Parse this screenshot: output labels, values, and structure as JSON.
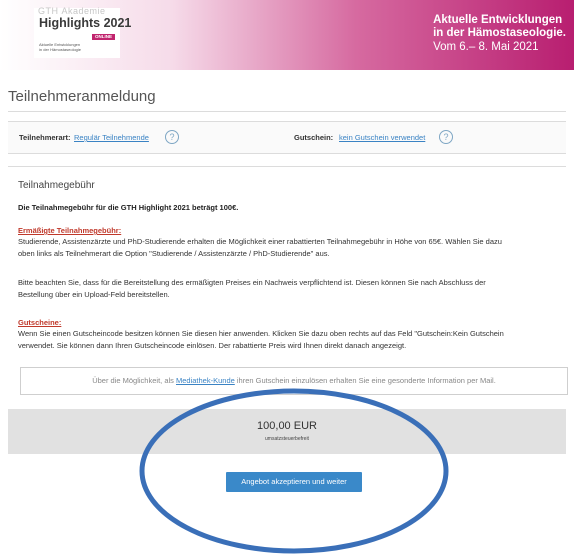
{
  "banner": {
    "logo_gth": "GTH",
    "logo_akademie": "Akademie",
    "logo_title": "Highlights 2021",
    "logo_online": "ONLINE",
    "logo_sub1": "Aktuelle Entwicklungen",
    "logo_sub2": "in der Hämostaseologie",
    "line1": "Aktuelle Entwicklungen",
    "line2": "in der Hämostaseologie.",
    "line3": "Vom 6.– 8. Mai 2021"
  },
  "page_title": "Teilnehmeranmeldung",
  "info_row": {
    "type_label": "Teilnehmerart:",
    "type_value": "Regulär Teilnehmende",
    "voucher_label": "Gutschein:",
    "voucher_value": "kein Gutschein verwendet",
    "help_glyph": "?"
  },
  "fee": {
    "title": "Teilnahmegebühr",
    "fee_line": "Die Teilnahmegebühr für die GTH Highlight 2021 beträgt 100€.",
    "reduced_heading": "Ermäßigte Teilnahmegebühr:",
    "reduced_p1_l1": "Studierende, Assistenzärzte und PhD-Studierende erhalten die Möglichkeit einer rabattierten Teilnahmegebühr in Höhe von 65€. Wählen Sie dazu",
    "reduced_p1_l2": "oben links als Teilnehmerart die Option \"Studierende / Assistenzärzte / PhD-Studierende\" aus.",
    "reduced_p2_l1": "Bitte beachten Sie, dass für die Bereitstellung des ermäßigten Preises ein Nachweis verpflichtend ist. Diesen können Sie nach Abschluss der",
    "reduced_p2_l2": "Bestellung über ein Upload-Feld bereitstellen.",
    "voucher_heading": "Gutscheine:",
    "voucher_l1": "Wenn Sie einen Gutscheincode besitzen können Sie diesen hier anwenden. Klicken Sie dazu oben rechts auf das Feld \"Gutschein:Kein Gutschein",
    "voucher_l2": "verwendet. Sie können dann Ihren Gutscheincode einlösen. Der rabattierte Preis wird Ihnen direkt danach angezeigt.",
    "mediathek_pre": "Über die Möglichkeit, als ",
    "mediathek_link": "Mediathek-Kunde",
    "mediathek_post": " ihren Gutschein einzulösen erhalten Sie eine gesonderte Information per Mail."
  },
  "price": {
    "amount": "100,00 EUR",
    "tax_note": "umsatzsteuerbefreit"
  },
  "accept_button": "Angebot akzeptieren und weiter",
  "colors": {
    "accent": "#3a89c9",
    "brand": "#b81e70",
    "highlight_ring": "#3a6fb8",
    "warning_heading": "#c0392b"
  }
}
